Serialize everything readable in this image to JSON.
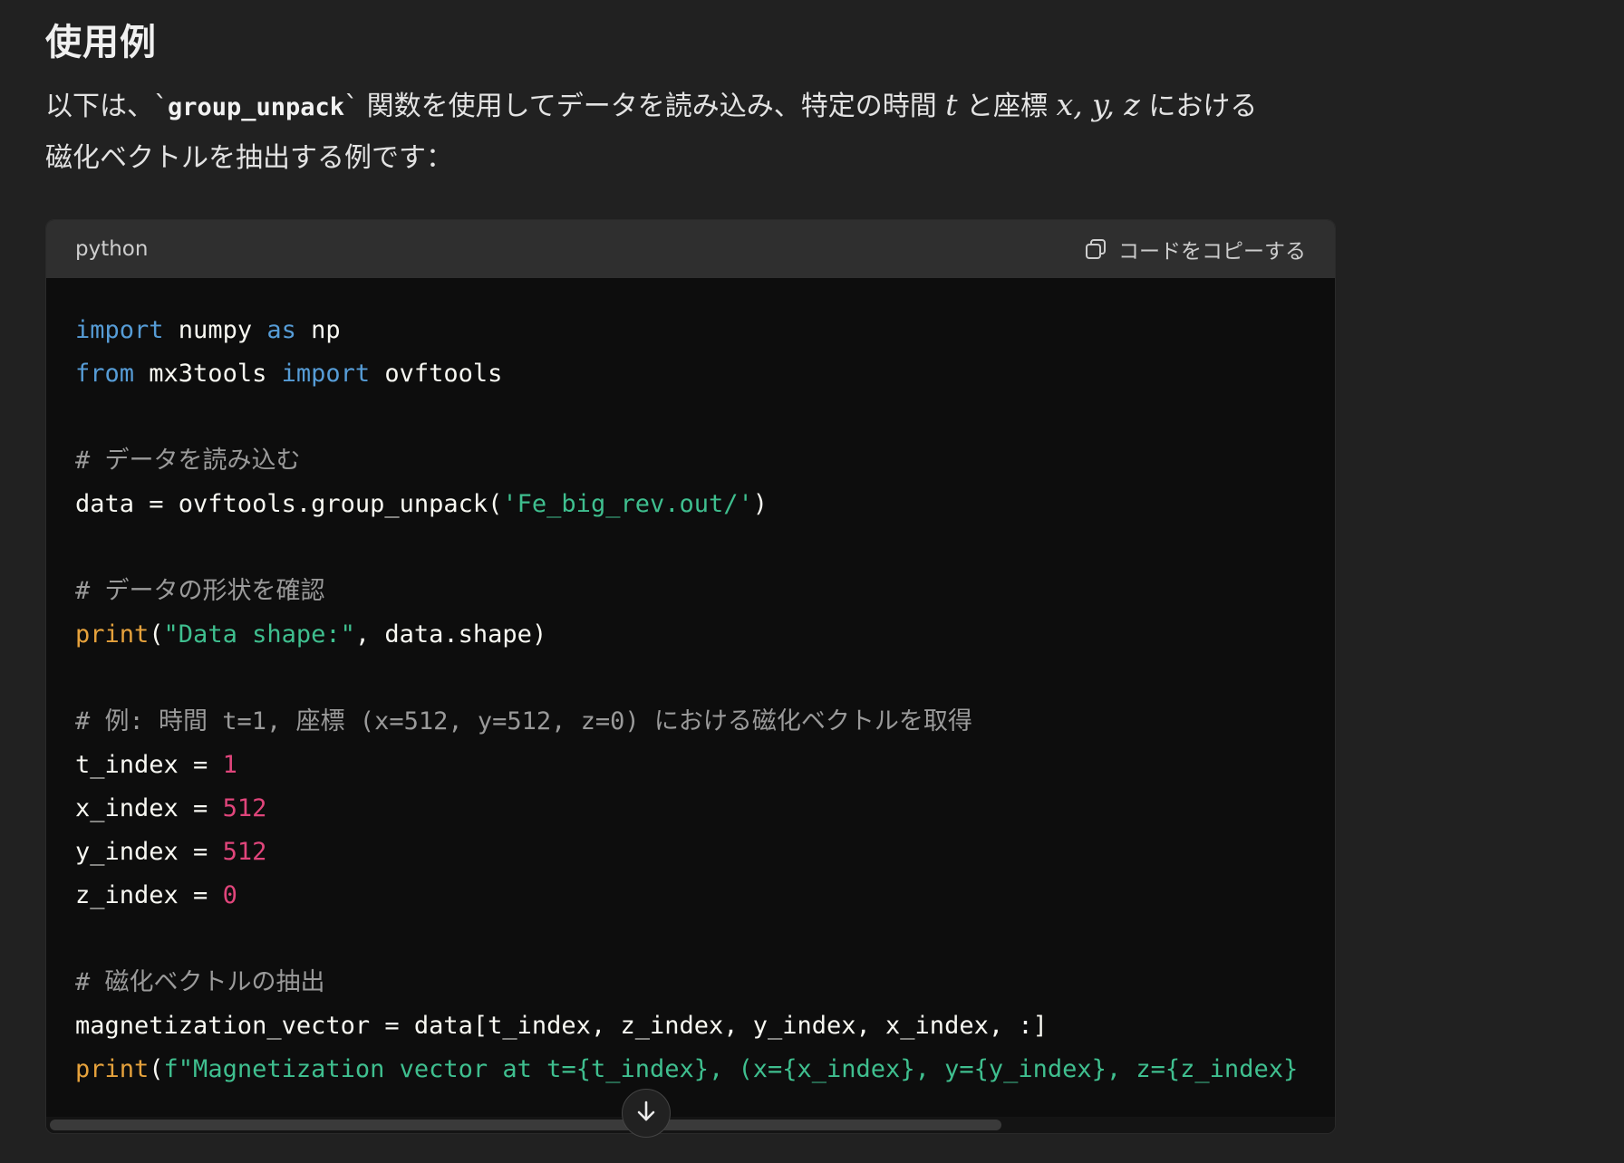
{
  "section": {
    "heading": "使用例",
    "para_part1": "以下は、`",
    "para_code": "group_unpack",
    "para_part2": "` 関数を使用してデータを読み込み、特定の時間 ",
    "para_math_t": "t",
    "para_part3": " と座標 ",
    "para_math_xyz": "x, y, z",
    "para_part4": " における",
    "para_line2": "磁化ベクトルを抽出する例です："
  },
  "codeblock": {
    "language": "python",
    "copy_label": "コードをコピーする",
    "lines": {
      "l1_kw1": "import",
      "l1_rest1": " numpy ",
      "l1_kw2": "as",
      "l1_rest2": " np",
      "l2_kw1": "from",
      "l2_rest1": " mx3tools ",
      "l2_kw2": "import",
      "l2_rest2": " ovftools",
      "l4_cm": "# データを読み込む",
      "l5_pre": "data = ovftools.group_unpack(",
      "l5_str": "'Fe_big_rev.out/'",
      "l5_post": ")",
      "l7_cm": "# データの形状を確認",
      "l8_fn": "print",
      "l8_p1": "(",
      "l8_str": "\"Data shape:\"",
      "l8_post": ", data.shape)",
      "l10_cm": "# 例: 時間 t=1, 座標 (x=512, y=512, z=0) における磁化ベクトルを取得",
      "l11_pre": "t_index = ",
      "l11_num": "1",
      "l12_pre": "x_index = ",
      "l12_num": "512",
      "l13_pre": "y_index = ",
      "l13_num": "512",
      "l14_pre": "z_index = ",
      "l14_num": "0",
      "l16_cm": "# 磁化ベクトルの抽出",
      "l17": "magnetization_vector = data[t_index, z_index, y_index, x_index, :]",
      "l18_fn": "print",
      "l18_p1": "(",
      "l18_str": "f\"Magnetization vector at t={t_index}, (x={x_index}, y={y_index}, z={z_index}"
    }
  },
  "icons": {
    "copy": "copy-icon",
    "scroll_down": "arrow-down-icon"
  },
  "colors": {
    "background": "#212121",
    "code_background": "#0d0d0d",
    "keyword": "#569cd6",
    "function": "#e6a23c",
    "string": "#3fbf8f",
    "number": "#e0457b",
    "comment": "#9a9a9a"
  }
}
